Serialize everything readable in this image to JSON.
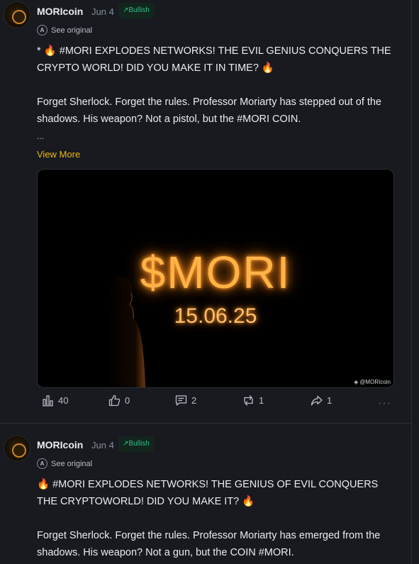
{
  "posts": [
    {
      "author": "MORIcoin",
      "date": "Jun 4",
      "badge": "Bullish",
      "see_original": "See original",
      "headline": "* 🔥 #MORI EXPLODES NETWORKS! THE EVIL GENIUS CONQUERS THE CRYPTO WORLD! DID YOU MAKE IT IN TIME? 🔥",
      "paragraph": "Forget Sherlock. Forget the rules. Professor Moriarty has stepped out of the shadows. His weapon? Not a pistol, but the #MORI COIN.",
      "ellipsis": "...",
      "view_more": "View More",
      "media": {
        "title": "$MORI",
        "date": "15.06.25",
        "watermark": "@MORIcoin"
      },
      "stats": {
        "views": "40",
        "likes": "0",
        "comments": "2",
        "reposts": "1",
        "shares": "1",
        "more": "···"
      }
    },
    {
      "author": "MORIcoin",
      "date": "Jun 4",
      "badge": "Bullish",
      "see_original": "See original",
      "headline": "🔥 #MORI EXPLODES NETWORKS! THE GENIUS OF EVIL CONQUERS THE CRYPTOWORLD! DID YOU MAKE IT? 🔥",
      "paragraph": "Forget Sherlock. Forget the rules. Professor Moriarty has emerged from the shadows. His weapon? Not a gun, but the COIN #MORI."
    }
  ],
  "colors": {
    "background": "#181a20",
    "accent": "#f0b90b",
    "bullish": "#2ebd85",
    "glow": "#ffb347"
  }
}
